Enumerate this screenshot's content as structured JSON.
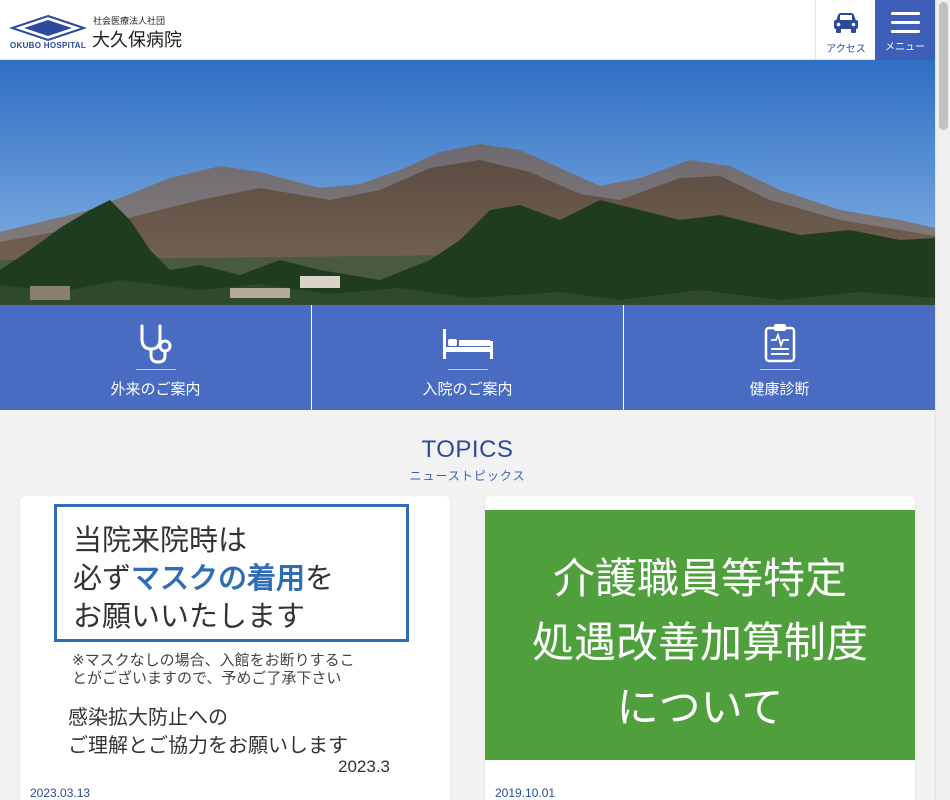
{
  "header": {
    "corp": "社会医療法人社団",
    "hospital_name": "大久保病院",
    "logo_en": "OKUBO HOSPITAL",
    "access_label": "アクセス",
    "menu_label": "メニュー"
  },
  "nav": [
    {
      "label": "外来のご案内",
      "icon": "stethoscope-icon"
    },
    {
      "label": "入院のご案内",
      "icon": "bed-icon"
    },
    {
      "label": "健康診断",
      "icon": "clipboard-icon"
    }
  ],
  "topics": {
    "title": "TOPICS",
    "subtitle": "ニューストピックス",
    "cards": [
      {
        "date": "2023.03.13",
        "image_text": {
          "line1": "当院来院時は",
          "line2_prefix": "必ず",
          "line2_em": "マスクの着用",
          "line2_suffix": "を",
          "line3": "お願いいたします",
          "note1": "※マスクなしの場合、入館をお断りするこ",
          "note2": "とがございますので、予めご了承下さい",
          "body1": "感染拡大防止への",
          "body2": "ご理解とご協力をお願いします",
          "year": "2023.3"
        }
      },
      {
        "date": "2019.10.01",
        "image_text": {
          "line1": "介護職員等特定",
          "line2": "処遇改善加算制度",
          "line3": "について"
        }
      }
    ]
  },
  "colors": {
    "primary": "#3d5fb8",
    "nav_bg": "#4a6bc2",
    "accent_line": "#d6e070",
    "green": "#4fa03c",
    "mask_blue": "#2f6db5"
  }
}
